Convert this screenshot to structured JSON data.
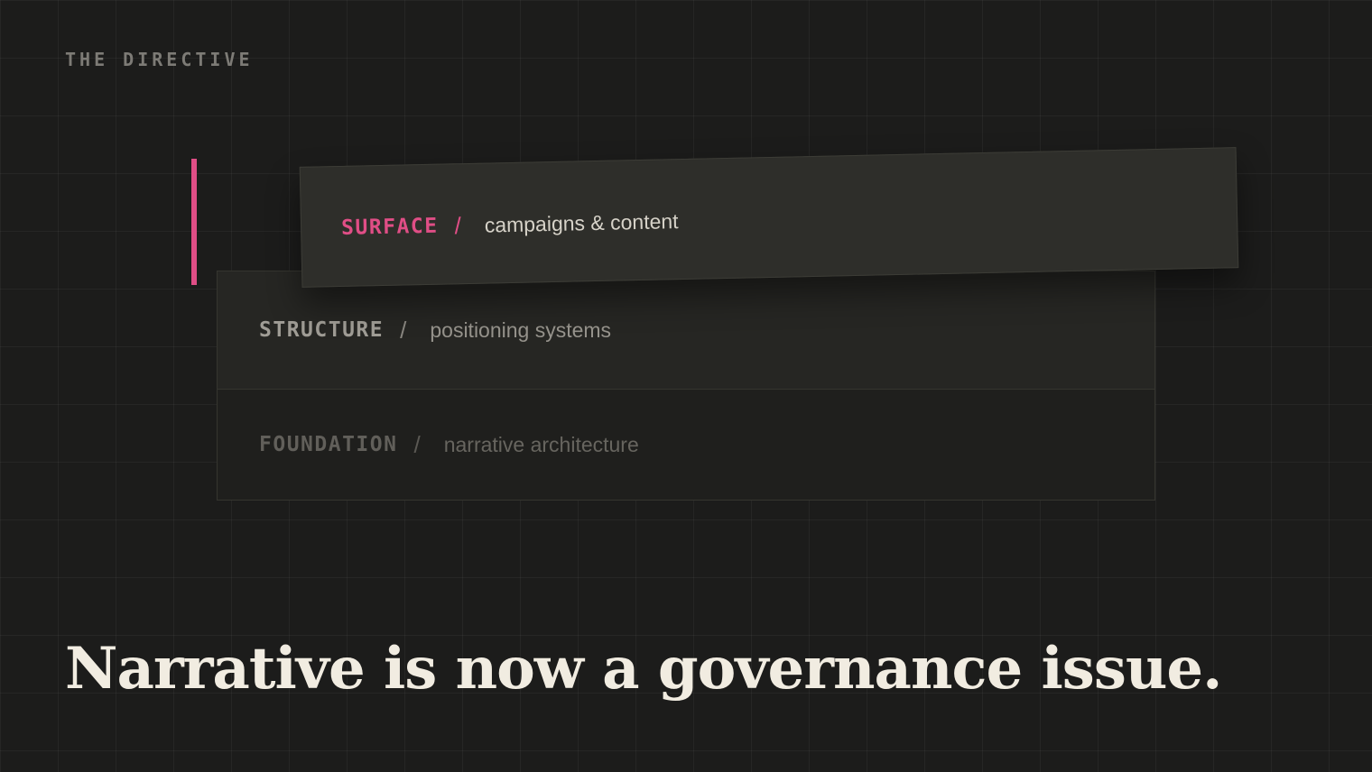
{
  "brand": "THE DIRECTIVE",
  "separator": "/",
  "layers": [
    {
      "name": "SURFACE",
      "description": "campaigns & content",
      "highlighted": true
    },
    {
      "name": "STRUCTURE",
      "description": "positioning systems",
      "highlighted": false
    },
    {
      "name": "FOUNDATION",
      "description": "narrative architecture",
      "highlighted": false
    }
  ],
  "headline": "Narrative is now a governance issue.",
  "colors": {
    "background": "#1c1c1b",
    "accent": "#e04e86",
    "headline": "#f1ece1"
  }
}
